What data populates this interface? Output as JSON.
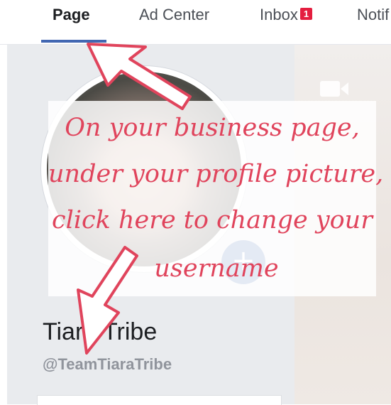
{
  "nav": {
    "tabs": [
      {
        "label": "Page",
        "active": true
      },
      {
        "label": "Ad Center"
      },
      {
        "label": "Inbox",
        "badge": "1"
      },
      {
        "label": "Notif"
      }
    ]
  },
  "profile": {
    "name": "Tiara Tribe",
    "username": "@TeamTiaraTribe",
    "add_photo_icon": "plus-icon"
  },
  "annotation": {
    "lines": [
      "On your business page,",
      "under your profile picture,",
      "click here to change your",
      "username"
    ]
  },
  "colors": {
    "accent": "#4267b2",
    "annotation": "#e0445c",
    "badge": "#e41e3f"
  }
}
